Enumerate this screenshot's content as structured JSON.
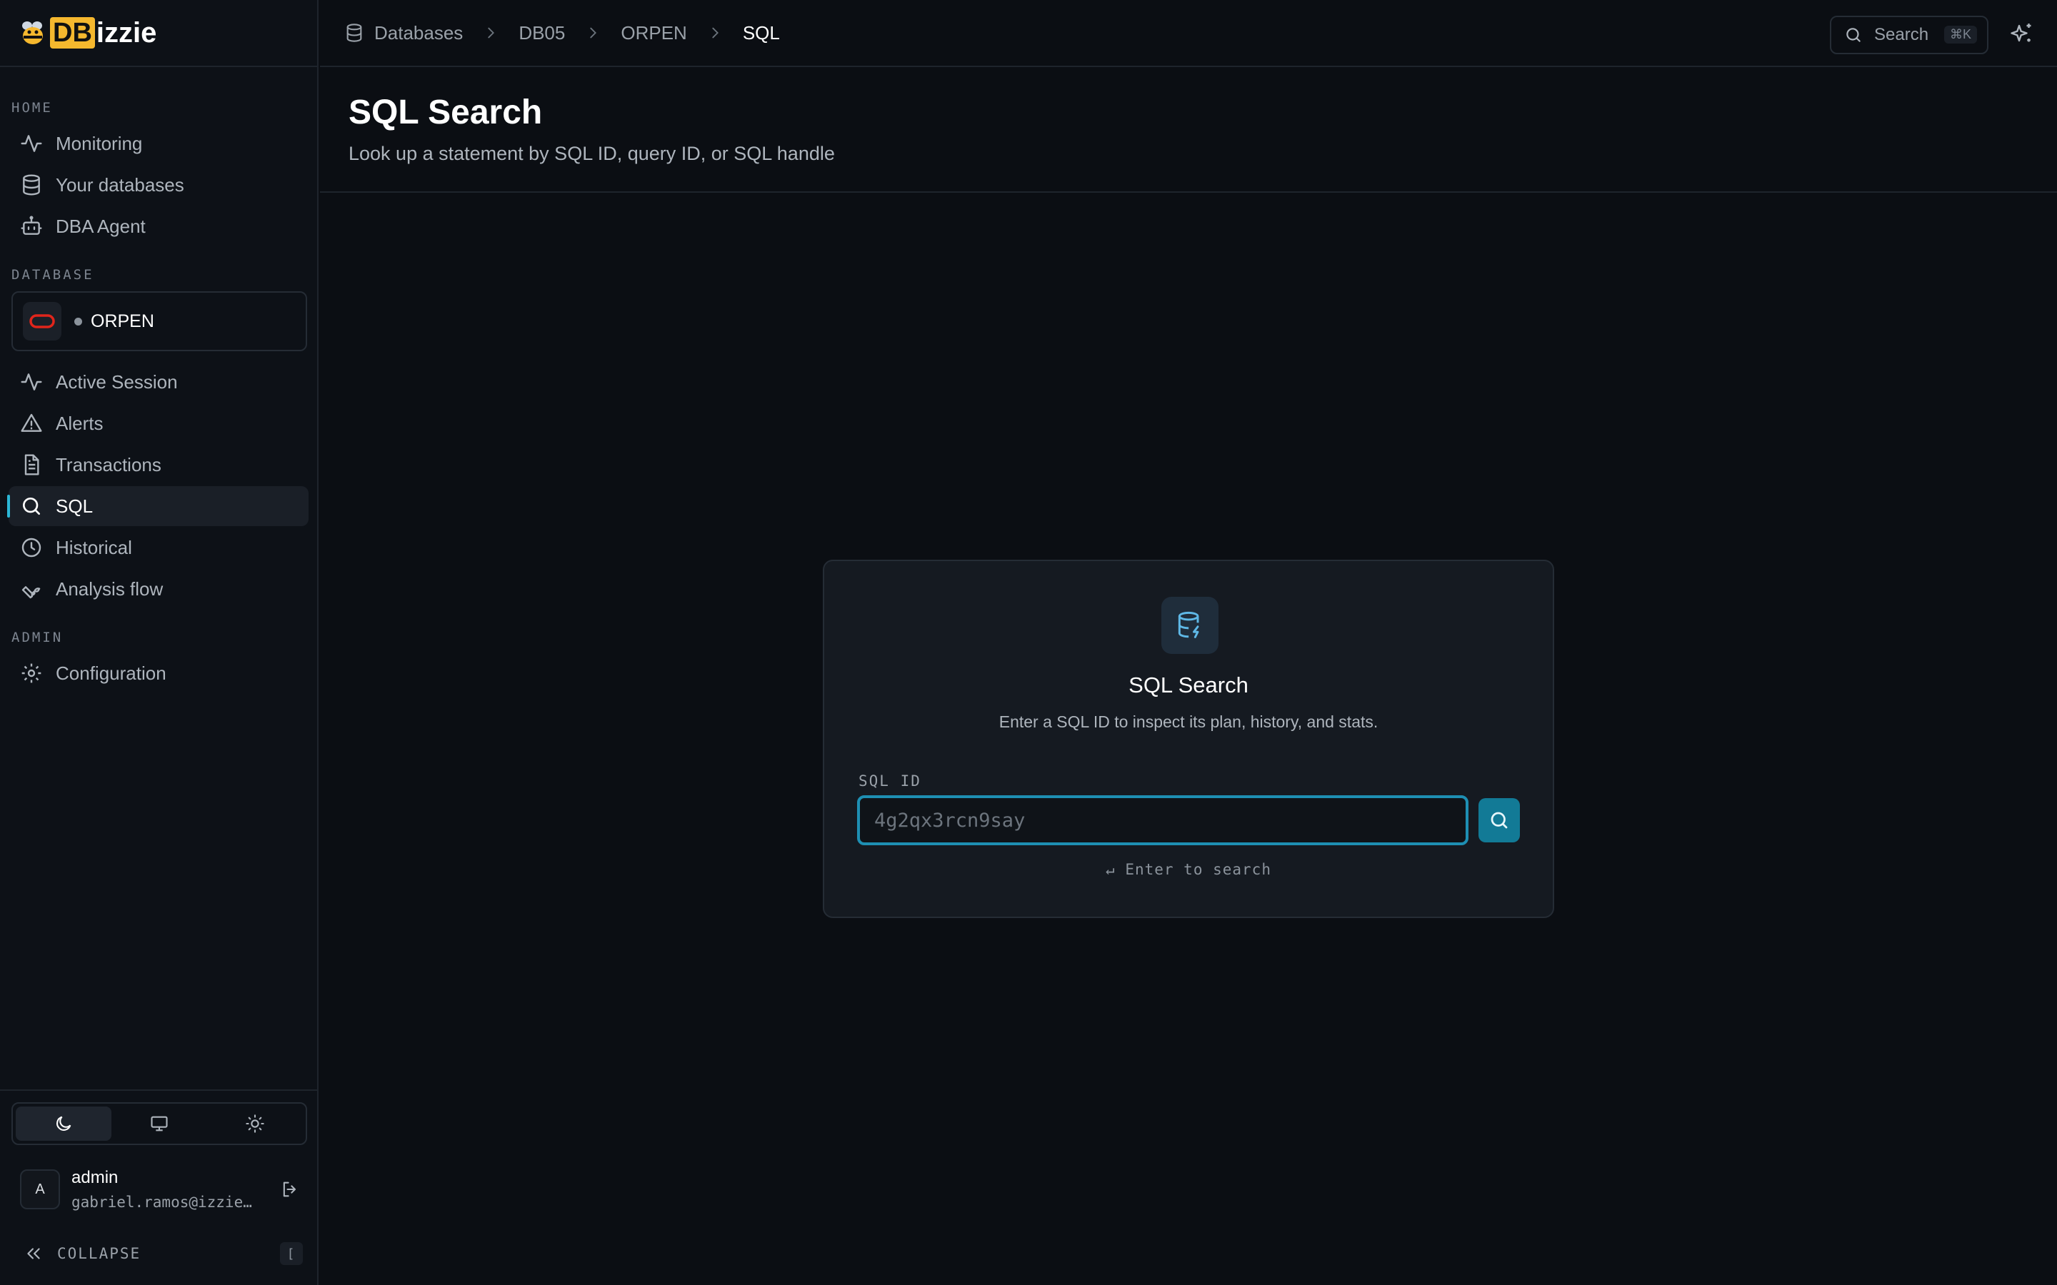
{
  "brand": {
    "db": "DB",
    "izzie": "izzie"
  },
  "sidebar": {
    "home_label": "HOME",
    "home_items": [
      {
        "label": "Monitoring",
        "icon": "activity-icon"
      },
      {
        "label": "Your databases",
        "icon": "database-icon"
      },
      {
        "label": "DBA Agent",
        "icon": "bot-icon"
      }
    ],
    "database_label": "DATABASE",
    "database_card": {
      "name": "ORPEN",
      "status_color": "#8b939c",
      "logo": "oracle-logo"
    },
    "db_items": [
      {
        "label": "Active Session",
        "icon": "activity-icon"
      },
      {
        "label": "Alerts",
        "icon": "alert-triangle-icon"
      },
      {
        "label": "Transactions",
        "icon": "file-text-icon"
      },
      {
        "label": "SQL",
        "icon": "search-icon",
        "active": true
      },
      {
        "label": "Historical",
        "icon": "clock-icon"
      },
      {
        "label": "Analysis flow",
        "icon": "wrench-icon"
      }
    ],
    "admin_label": "ADMIN",
    "admin_items": [
      {
        "label": "Configuration",
        "icon": "gear-icon"
      }
    ],
    "theme": {
      "selected": "dark",
      "options": [
        "dark",
        "system",
        "light"
      ]
    },
    "user": {
      "avatar": "A",
      "name": "admin",
      "email": "gabriel.ramos@izzie…"
    },
    "collapse_label": "COLLAPSE",
    "collapse_key": "["
  },
  "topbar": {
    "breadcrumb": [
      "Databases",
      "DB05",
      "ORPEN",
      "SQL"
    ],
    "search_label": "Search",
    "search_shortcut": "⌘K"
  },
  "header": {
    "title": "SQL Search",
    "subtitle": "Look up a statement by SQL ID, query ID, or SQL handle"
  },
  "card": {
    "title": "SQL Search",
    "description": "Enter a SQL ID to inspect its plan, history, and stats.",
    "field_label": "SQL ID",
    "placeholder": "4g2qx3rcn9say",
    "value": "",
    "hint": "↵ Enter to search"
  },
  "colors": {
    "accent": "#2bb7d6",
    "brand": "#f5b82e",
    "button": "#127a96"
  }
}
